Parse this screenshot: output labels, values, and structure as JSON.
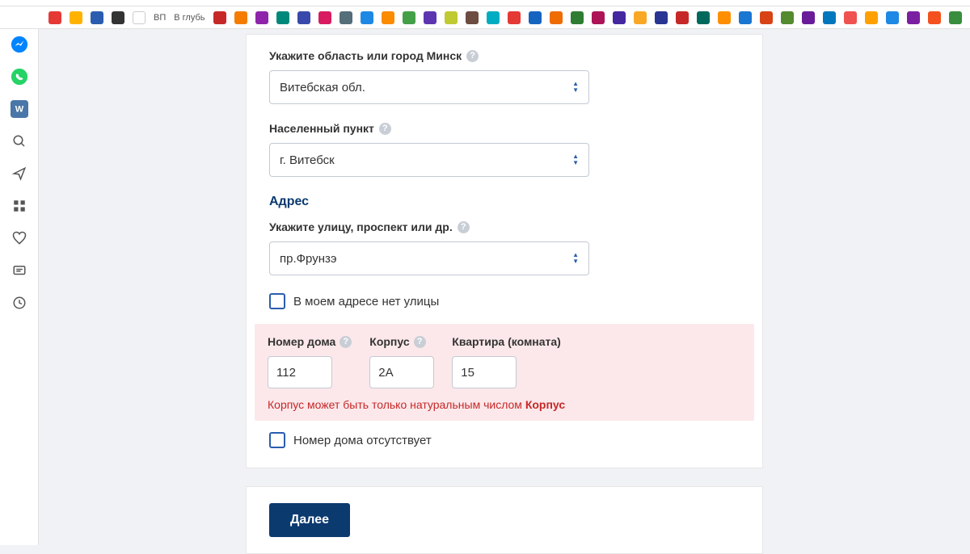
{
  "bookmarks": {
    "text_label": "В глубь"
  },
  "form": {
    "region_label": "Укажите область или город Минск",
    "region_value": "Витебская обл.",
    "locality_label": "Населенный пункт",
    "locality_value": "г. Витебск",
    "address_title": "Адрес",
    "street_label": "Укажите улицу, проспект или др.",
    "street_value": "пр.Фрунзэ",
    "no_street_label": "В моем адресе нет улицы",
    "house_label": "Номер дома",
    "house_value": "112",
    "corpus_label": "Корпус",
    "corpus_value": "2А",
    "apartment_label": "Квартира (комната)",
    "apartment_value": "15",
    "error_text": "Корпус может быть только натуральным числом",
    "error_field": "Корпус",
    "no_house_label": "Номер дома отсутствует",
    "next_button": "Далее"
  }
}
